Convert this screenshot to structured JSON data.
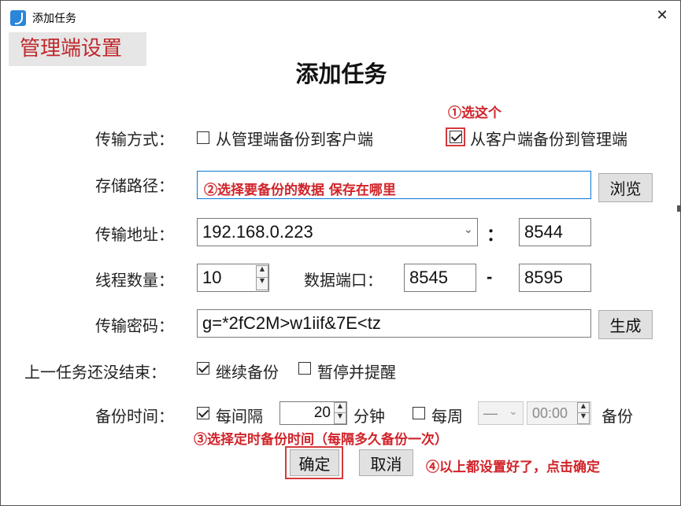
{
  "window": {
    "title": "添加任务",
    "close_glyph": "✕"
  },
  "banner": "管理端设置",
  "heading": "添加任务",
  "annotations": {
    "step1": "①选这个",
    "step2": "②选择要备份的数据 保存在哪里",
    "step3": "③选择定时备份时间（每隔多久备份一次）",
    "step4": "④以上都设置好了，点击确定"
  },
  "transfer_mode": {
    "label": "传输方式：",
    "option1": {
      "label": "从管理端备份到客户端",
      "checked": false
    },
    "option2": {
      "label": "从客户端备份到管理端",
      "checked": true
    }
  },
  "storage_path": {
    "label": "存储路径：",
    "value": "",
    "browse": "浏览"
  },
  "address": {
    "label": "传输地址：",
    "ip": "192.168.0.223",
    "colon": "：",
    "port": "8544"
  },
  "threads": {
    "label": "线程数量：",
    "value": "10",
    "data_port_label": "数据端口：",
    "port_start": "8545",
    "dash": "-",
    "port_end": "8595"
  },
  "password": {
    "label": "传输密码：",
    "value": "g=*2fC2M>w1iif&7E<tz",
    "generate": "生成"
  },
  "unfinished": {
    "label": "上一任务还没结束：",
    "option1": {
      "label": "继续备份",
      "checked": true
    },
    "option2": {
      "label": "暂停并提醒",
      "checked": false
    }
  },
  "schedule": {
    "label": "备份时间：",
    "interval": {
      "label": "每间隔",
      "checked": true,
      "value": "20",
      "unit": "分钟"
    },
    "weekly": {
      "label": "每周",
      "checked": false,
      "day": "—",
      "time": "00:00",
      "suffix": "备份"
    }
  },
  "buttons": {
    "ok": "确定",
    "cancel": "取消"
  },
  "colors": {
    "annotation": "#d0242a",
    "focus": "#0a78d7",
    "highlight_box": "#d43a3d"
  }
}
